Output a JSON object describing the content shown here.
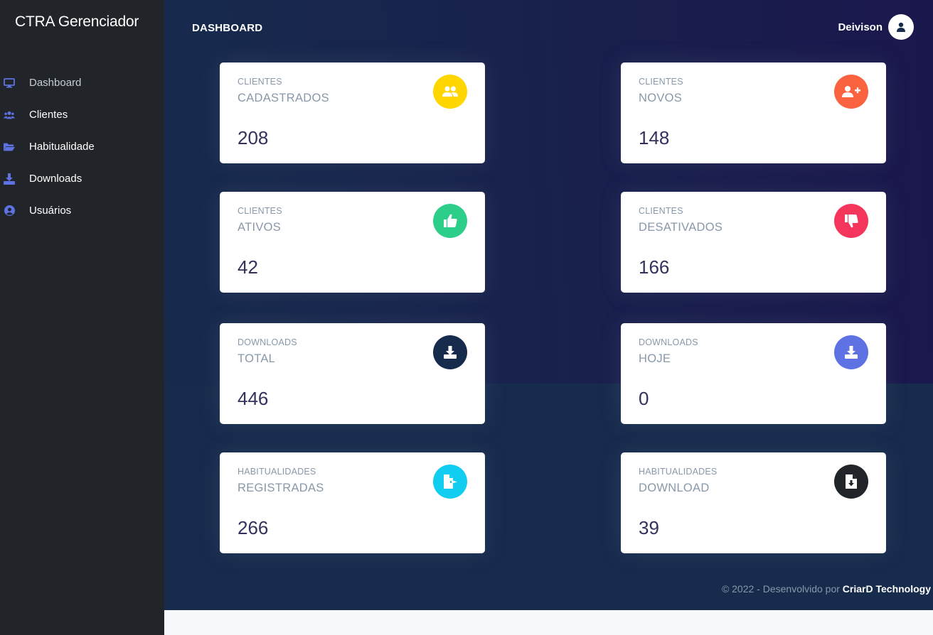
{
  "sidebar": {
    "brand": "CTRA Gerenciador",
    "items": [
      {
        "label": "Dashboard",
        "icon": "monitor-icon"
      },
      {
        "label": "Clientes",
        "icon": "users-icon"
      },
      {
        "label": "Habitualidade",
        "icon": "folder-open-icon"
      },
      {
        "label": "Downloads",
        "icon": "download-icon"
      },
      {
        "label": "Usuários",
        "icon": "user-circle-icon"
      }
    ]
  },
  "header": {
    "title": "DASHBOARD",
    "user_name": "Deivison"
  },
  "cards": [
    {
      "category": "CLIENTES",
      "subtitle": "CADASTRADOS",
      "value": "208",
      "icon": "users-icon",
      "color": "#ffd600"
    },
    {
      "category": "CLIENTES",
      "subtitle": "NOVOS",
      "value": "148",
      "icon": "user-plus-icon",
      "color": "#fb6340"
    },
    {
      "category": "CLIENTES",
      "subtitle": "ATIVOS",
      "value": "42",
      "icon": "thumbs-up-icon",
      "color": "#2dce89"
    },
    {
      "category": "CLIENTES",
      "subtitle": "DESATIVADOS",
      "value": "166",
      "icon": "thumbs-down-icon",
      "color": "#f5365c"
    },
    {
      "category": "DOWNLOADS",
      "subtitle": "TOTAL",
      "value": "446",
      "icon": "download-icon",
      "color": "#172b4d"
    },
    {
      "category": "DOWNLOADS",
      "subtitle": "HOJE",
      "value": "0",
      "icon": "download-icon",
      "color": "#5e72e4"
    },
    {
      "category": "HABITUALIDADES",
      "subtitle": "REGISTRADAS",
      "value": "266",
      "icon": "file-export-icon",
      "color": "#11cdef"
    },
    {
      "category": "HABITUALIDADES",
      "subtitle": "DOWNLOAD",
      "value": "39",
      "icon": "file-download-icon",
      "color": "#212529"
    }
  ],
  "footer": {
    "text": "© 2022 - Desenvolvido por ",
    "company": "CriarD Technology"
  },
  "colors": {
    "sidebar_bg": "#212529",
    "main_bg": "#172b4d",
    "nav_icon": "#5e72e4"
  }
}
